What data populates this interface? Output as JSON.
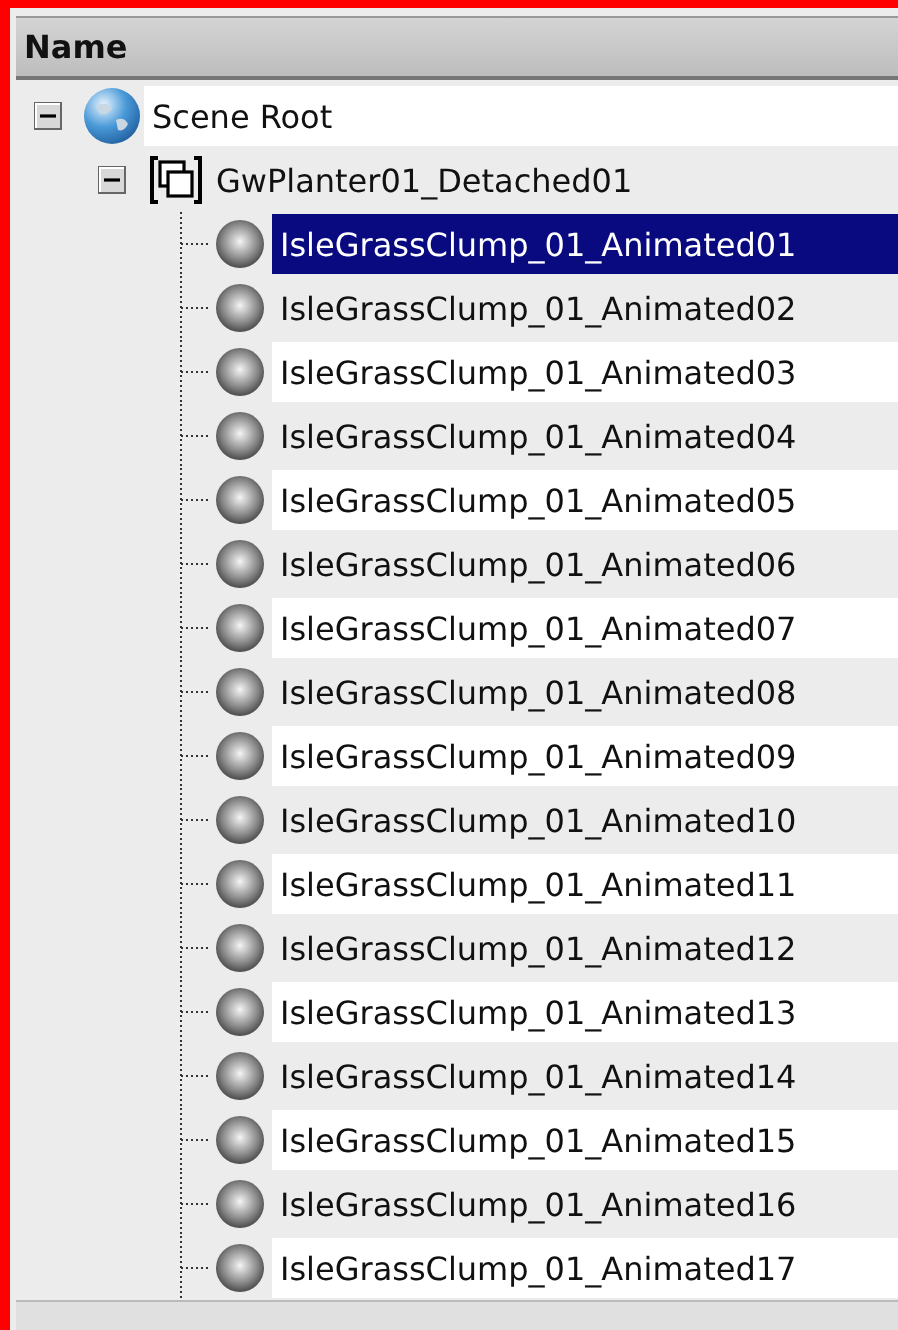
{
  "header": {
    "column": "Name"
  },
  "tree": [
    {
      "label": "Scene Root",
      "kind": "scene",
      "expanded": true,
      "selected": false,
      "children": [
        {
          "label": "GwPlanter01_Detached01",
          "kind": "group",
          "expanded": true,
          "selected": false,
          "children": [
            {
              "label": "IsleGrassClump_01_Animated01",
              "kind": "object",
              "selected": true
            },
            {
              "label": "IsleGrassClump_01_Animated02",
              "kind": "object",
              "selected": false
            },
            {
              "label": "IsleGrassClump_01_Animated03",
              "kind": "object",
              "selected": false
            },
            {
              "label": "IsleGrassClump_01_Animated04",
              "kind": "object",
              "selected": false
            },
            {
              "label": "IsleGrassClump_01_Animated05",
              "kind": "object",
              "selected": false
            },
            {
              "label": "IsleGrassClump_01_Animated06",
              "kind": "object",
              "selected": false
            },
            {
              "label": "IsleGrassClump_01_Animated07",
              "kind": "object",
              "selected": false
            },
            {
              "label": "IsleGrassClump_01_Animated08",
              "kind": "object",
              "selected": false
            },
            {
              "label": "IsleGrassClump_01_Animated09",
              "kind": "object",
              "selected": false
            },
            {
              "label": "IsleGrassClump_01_Animated10",
              "kind": "object",
              "selected": false
            },
            {
              "label": "IsleGrassClump_01_Animated11",
              "kind": "object",
              "selected": false
            },
            {
              "label": "IsleGrassClump_01_Animated12",
              "kind": "object",
              "selected": false
            },
            {
              "label": "IsleGrassClump_01_Animated13",
              "kind": "object",
              "selected": false
            },
            {
              "label": "IsleGrassClump_01_Animated14",
              "kind": "object",
              "selected": false
            },
            {
              "label": "IsleGrassClump_01_Animated15",
              "kind": "object",
              "selected": false
            },
            {
              "label": "IsleGrassClump_01_Animated16",
              "kind": "object",
              "selected": false
            },
            {
              "label": "IsleGrassClump_01_Animated17",
              "kind": "object",
              "selected": false
            }
          ]
        }
      ]
    }
  ]
}
